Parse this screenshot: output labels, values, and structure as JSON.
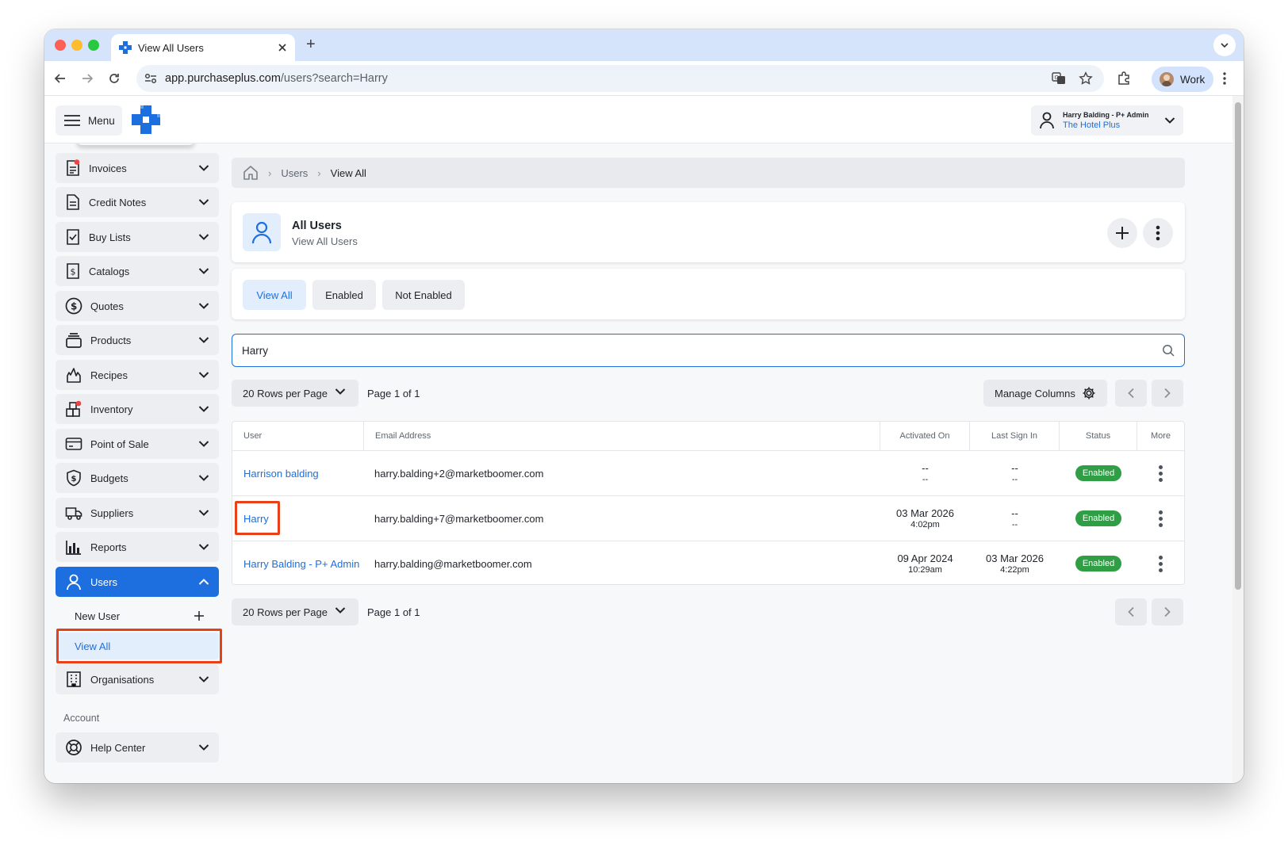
{
  "browser": {
    "tab_title": "View All Users",
    "new_tab": "+",
    "url_host": "app.purchaseplus.com",
    "url_path": "/users?search=Harry",
    "profile_label": "Work"
  },
  "topbar": {
    "menu_label": "Menu",
    "user_name": "Harry Balding - P+ Admin",
    "org_name": "The Hotel Plus"
  },
  "sidebar": {
    "items": [
      {
        "label": "Invoices"
      },
      {
        "label": "Credit Notes"
      },
      {
        "label": "Buy Lists"
      },
      {
        "label": "Catalogs"
      },
      {
        "label": "Quotes"
      },
      {
        "label": "Products"
      },
      {
        "label": "Recipes"
      },
      {
        "label": "Inventory"
      },
      {
        "label": "Point of Sale"
      },
      {
        "label": "Budgets"
      },
      {
        "label": "Suppliers"
      },
      {
        "label": "Reports"
      },
      {
        "label": "Users"
      }
    ],
    "users_sub": {
      "new_user": "New User",
      "view_all": "View All"
    },
    "organisations": "Organisations",
    "account_section": "Account",
    "help_center": "Help Center"
  },
  "breadcrumb": {
    "users": "Users",
    "view_all": "View All"
  },
  "header": {
    "title": "All Users",
    "subtitle": "View All Users"
  },
  "filters": [
    "View All",
    "Enabled",
    "Not Enabled"
  ],
  "search": {
    "value": "Harry"
  },
  "pagination": {
    "rows_per_page": "20 Rows per Page",
    "page_info": "Page 1 of 1",
    "manage_columns": "Manage Columns"
  },
  "table": {
    "columns": [
      "User",
      "Email Address",
      "Activated On",
      "Last Sign In",
      "Status",
      "More"
    ],
    "rows": [
      {
        "user": "Harrison balding",
        "email": "harry.balding+2@marketboomer.com",
        "activated_date": "--",
        "activated_time": "--",
        "signin_date": "--",
        "signin_time": "--",
        "status": "Enabled"
      },
      {
        "user": "Harry",
        "email": "harry.balding+7@marketboomer.com",
        "activated_date": "03 Mar 2026",
        "activated_time": "4:02pm",
        "signin_date": "--",
        "signin_time": "--",
        "status": "Enabled"
      },
      {
        "user": "Harry Balding - P+ Admin",
        "email": "harry.balding@marketboomer.com",
        "activated_date": "09 Apr 2024",
        "activated_time": "10:29am",
        "signin_date": "03 Mar 2026",
        "signin_time": "4:22pm",
        "status": "Enabled"
      }
    ]
  },
  "colors": {
    "accent": "#1d6fe0",
    "status_enabled": "#2f9e44",
    "highlight": "#e8411a"
  }
}
